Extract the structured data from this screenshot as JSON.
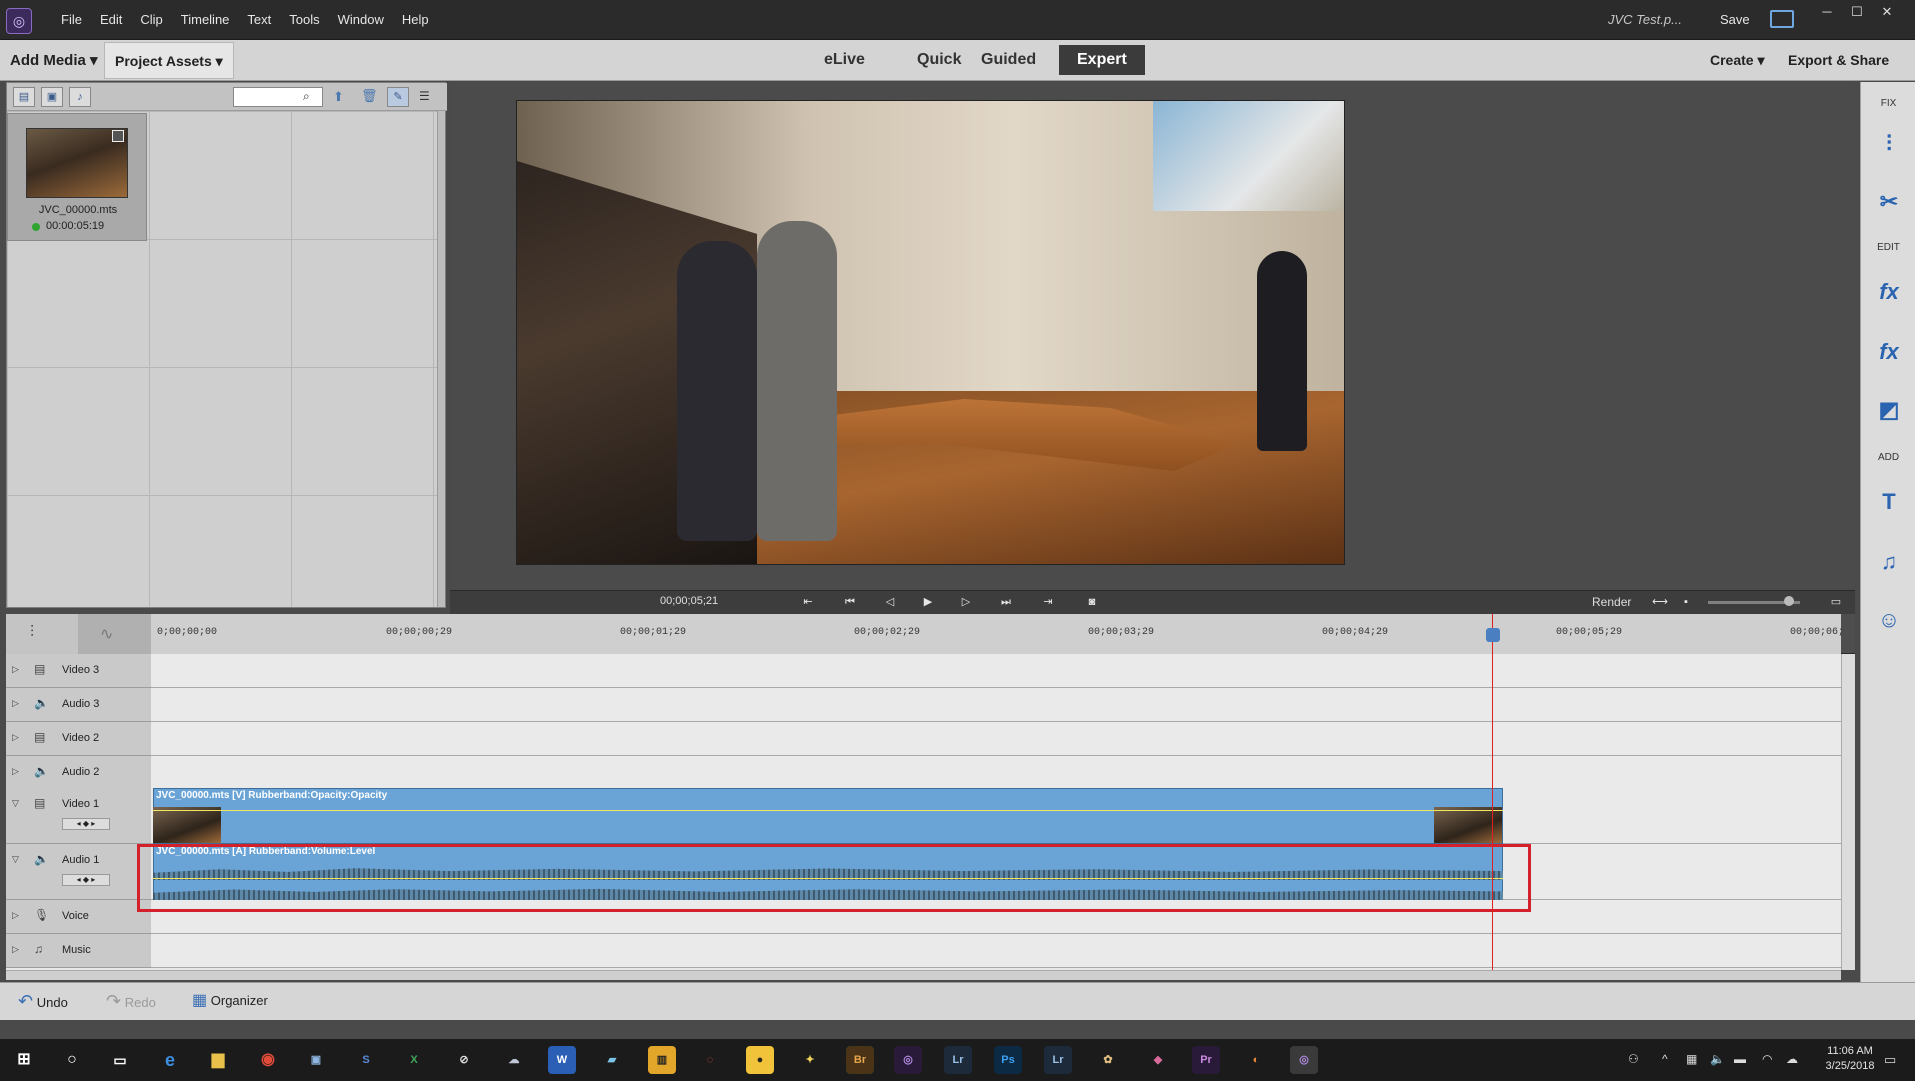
{
  "menubar": {
    "items": [
      "File",
      "Edit",
      "Clip",
      "Timeline",
      "Text",
      "Tools",
      "Window",
      "Help"
    ],
    "project_title": "JVC Test.p...",
    "save_label": "Save"
  },
  "toolbar": {
    "add_media": "Add Media",
    "project_assets": "Project Assets",
    "modes": [
      "eLive",
      "Quick",
      "Guided",
      "Expert"
    ],
    "active_mode": "Expert",
    "create": "Create",
    "export_share": "Export & Share"
  },
  "assets": {
    "items": [
      {
        "name": "JVC_00000.mts",
        "duration": "00:00:05:19"
      }
    ]
  },
  "monitor": {
    "timecode": "00;00;05;21",
    "render_label": "Render"
  },
  "sidebar": {
    "sections": {
      "fix": "FIX",
      "edit": "EDIT",
      "add": "ADD"
    },
    "icons": [
      "adjust-icon",
      "tools-icon",
      "fx-edit-icon",
      "fx-icon",
      "color-icon",
      "text-icon",
      "music-icon",
      "graphics-icon"
    ]
  },
  "timeline": {
    "ruler_ticks": [
      "0;00;00;00",
      "00;00;00;29",
      "00;00;01;29",
      "00;00;02;29",
      "00;00;03;29",
      "00;00;04;29",
      "00;00;05;29",
      "00;00;06;"
    ],
    "tracks": [
      {
        "name": "Video 3",
        "type": "video"
      },
      {
        "name": "Audio 3",
        "type": "audio"
      },
      {
        "name": "Video 2",
        "type": "video"
      },
      {
        "name": "Audio 2",
        "type": "audio"
      },
      {
        "name": "Video 1",
        "type": "video"
      },
      {
        "name": "Audio 1",
        "type": "audio"
      },
      {
        "name": "Voice",
        "type": "voice"
      },
      {
        "name": "Music",
        "type": "music"
      }
    ],
    "video_clip_label": "JVC_00000.mts [V] Rubberband:Opacity:Opacity",
    "audio_clip_label": "JVC_00000.mts [A] Rubberband:Volume:Level"
  },
  "bottombar": {
    "undo": "Undo",
    "redo": "Redo",
    "organizer": "Organizer"
  },
  "taskbar": {
    "time": "11:06 AM",
    "date": "3/25/2018",
    "apps": [
      "Br",
      "Lr",
      "Ps",
      "Lr",
      "Pr"
    ]
  },
  "colors": {
    "accent": "#2a64b0",
    "highlight": "#d4202a",
    "clip": "#6aa4d6",
    "playhead": "#e02020"
  }
}
